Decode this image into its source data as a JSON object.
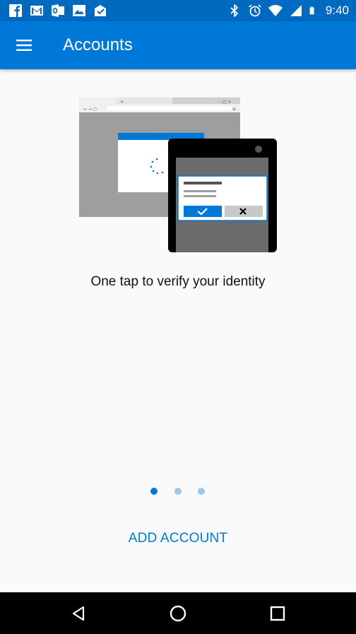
{
  "status_bar": {
    "time": "9:40",
    "left_icons": [
      "facebook-icon",
      "gmail-icon",
      "outlook-icon",
      "gallery-icon",
      "mail-check-icon"
    ],
    "right_icons": [
      "bluetooth-icon",
      "alarm-icon",
      "wifi-icon",
      "signal-icon",
      "battery-icon"
    ]
  },
  "app_bar": {
    "title": "Accounts",
    "menu_icon": "hamburger-menu-icon"
  },
  "onboarding": {
    "caption": "One tap to verify your identity",
    "current_page": 1,
    "total_pages": 3
  },
  "actions": {
    "add_account": "ADD ACCOUNT"
  },
  "nav_bar": {
    "icons": [
      "back-icon",
      "home-icon",
      "recent-apps-icon"
    ]
  },
  "colors": {
    "status_bar": "#0069c0",
    "app_bar": "#0078d7",
    "accent": "#0078d7",
    "inactive_dot": "#9cc7ec",
    "background": "#fafafa"
  }
}
